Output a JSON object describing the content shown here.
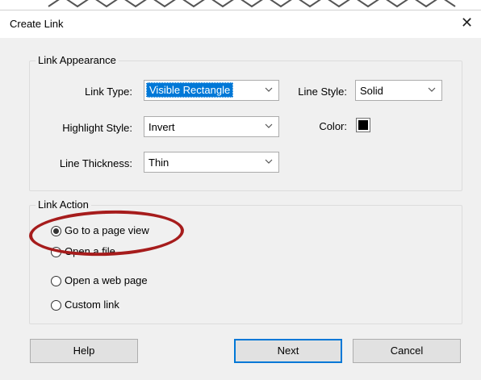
{
  "dialog": {
    "title": "Create Link"
  },
  "link_appearance": {
    "legend": "Link Appearance",
    "link_type": {
      "label": "Link Type:",
      "value": "Visible Rectangle"
    },
    "line_style": {
      "label": "Line Style:",
      "value": "Solid"
    },
    "highlight_style": {
      "label": "Highlight Style:",
      "value": "Invert"
    },
    "color": {
      "label": "Color:",
      "value": "#000000"
    },
    "line_thickness": {
      "label": "Line Thickness:",
      "value": "Thin"
    }
  },
  "link_action": {
    "legend": "Link Action",
    "options": [
      {
        "label": "Go to a page view",
        "selected": true
      },
      {
        "label": "Open a file",
        "selected": false
      },
      {
        "label": "Open a web page",
        "selected": false
      },
      {
        "label": "Custom link",
        "selected": false
      }
    ]
  },
  "buttons": {
    "help": "Help",
    "next": "Next",
    "cancel": "Cancel"
  },
  "colors": {
    "annotation": "#a61c1c",
    "selection": "#0078d7"
  }
}
